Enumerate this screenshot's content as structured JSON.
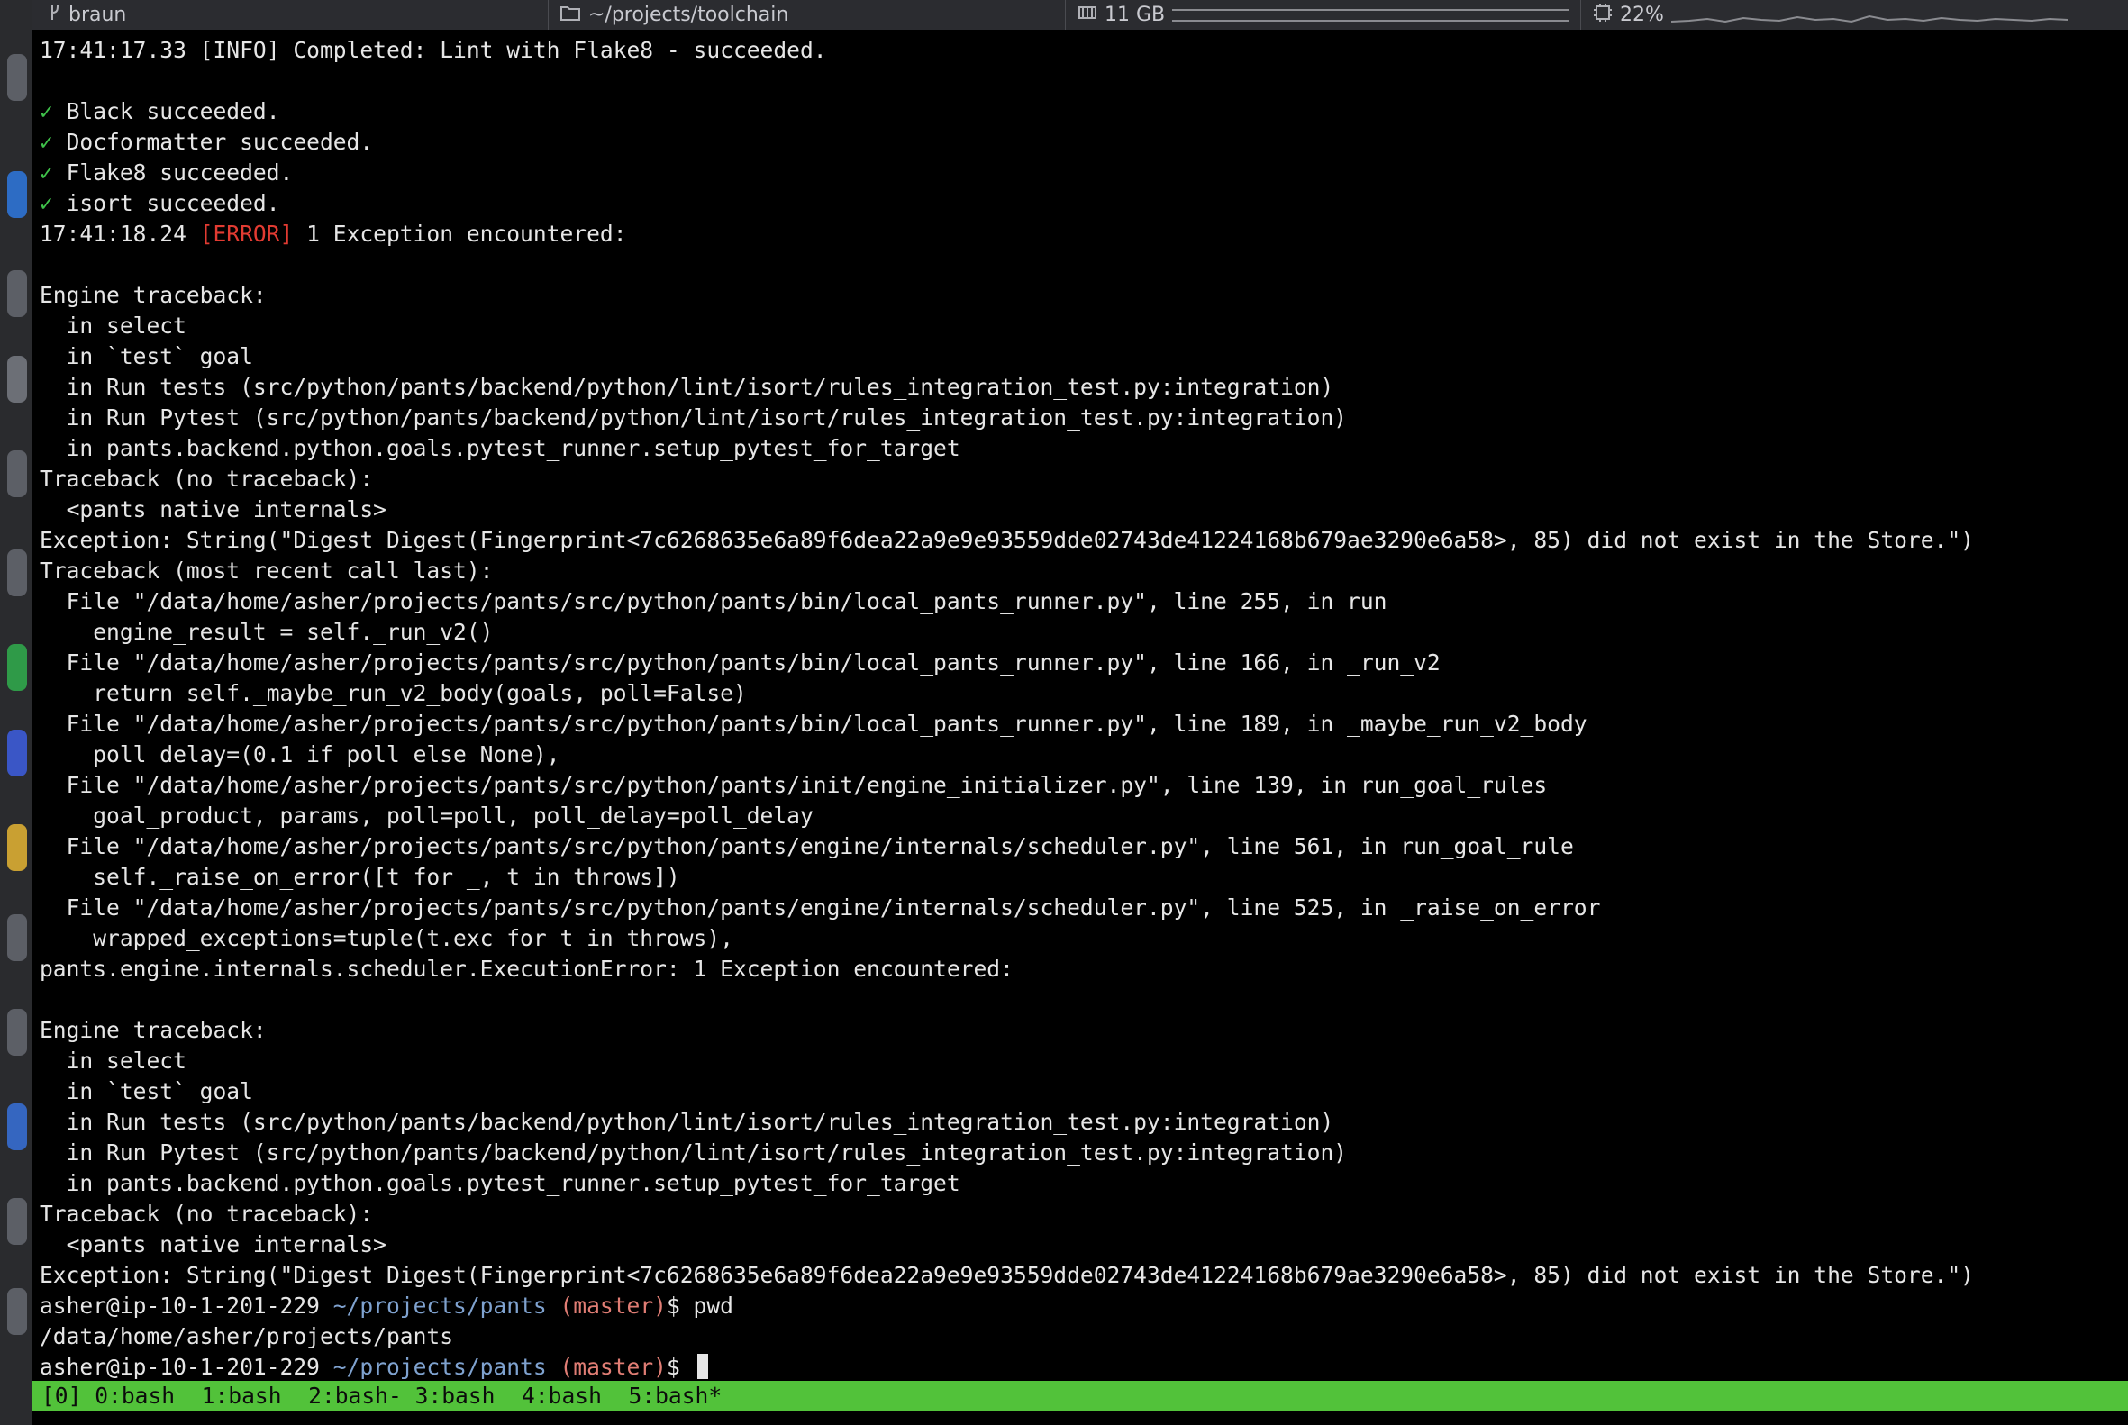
{
  "topbar": {
    "host_icon": "branch-icon",
    "host": "braun",
    "path_icon": "folder-icon",
    "path": "~/projects/toolchain",
    "mem_icon": "memory-icon",
    "mem": "11 GB",
    "cpu_icon": "cpu-icon",
    "cpu": "22%"
  },
  "terminal": {
    "lines": [
      {
        "text": "17:41:17.33 [INFO] Completed: Lint with Flake8 - succeeded."
      },
      {
        "text": ""
      },
      {
        "check": "✓",
        "text": " Black succeeded."
      },
      {
        "check": "✓",
        "text": " Docformatter succeeded."
      },
      {
        "check": "✓",
        "text": " Flake8 succeeded."
      },
      {
        "check": "✓",
        "text": " isort succeeded."
      },
      {
        "pre": "17:41:18.24 ",
        "err": "[ERROR]",
        "post": " 1 Exception encountered:"
      },
      {
        "text": ""
      },
      {
        "text": "Engine traceback:"
      },
      {
        "text": "  in select"
      },
      {
        "text": "  in `test` goal"
      },
      {
        "text": "  in Run tests (src/python/pants/backend/python/lint/isort/rules_integration_test.py:integration)"
      },
      {
        "text": "  in Run Pytest (src/python/pants/backend/python/lint/isort/rules_integration_test.py:integration)"
      },
      {
        "text": "  in pants.backend.python.goals.pytest_runner.setup_pytest_for_target"
      },
      {
        "text": "Traceback (no traceback):"
      },
      {
        "text": "  <pants native internals>"
      },
      {
        "text": "Exception: String(\"Digest Digest(Fingerprint<7c6268635e6a89f6dea22a9e9e93559dde02743de41224168b679ae3290e6a58>, 85) did not exist in the Store.\")"
      },
      {
        "text": "Traceback (most recent call last):"
      },
      {
        "text": "  File \"/data/home/asher/projects/pants/src/python/pants/bin/local_pants_runner.py\", line 255, in run"
      },
      {
        "text": "    engine_result = self._run_v2()"
      },
      {
        "text": "  File \"/data/home/asher/projects/pants/src/python/pants/bin/local_pants_runner.py\", line 166, in _run_v2"
      },
      {
        "text": "    return self._maybe_run_v2_body(goals, poll=False)"
      },
      {
        "text": "  File \"/data/home/asher/projects/pants/src/python/pants/bin/local_pants_runner.py\", line 189, in _maybe_run_v2_body"
      },
      {
        "text": "    poll_delay=(0.1 if poll else None),"
      },
      {
        "text": "  File \"/data/home/asher/projects/pants/src/python/pants/init/engine_initializer.py\", line 139, in run_goal_rules"
      },
      {
        "text": "    goal_product, params, poll=poll, poll_delay=poll_delay"
      },
      {
        "text": "  File \"/data/home/asher/projects/pants/src/python/pants/engine/internals/scheduler.py\", line 561, in run_goal_rule"
      },
      {
        "text": "    self._raise_on_error([t for _, t in throws])"
      },
      {
        "text": "  File \"/data/home/asher/projects/pants/src/python/pants/engine/internals/scheduler.py\", line 525, in _raise_on_error"
      },
      {
        "text": "    wrapped_exceptions=tuple(t.exc for t in throws),"
      },
      {
        "text": "pants.engine.internals.scheduler.ExecutionError: 1 Exception encountered:"
      },
      {
        "text": ""
      },
      {
        "text": "Engine traceback:"
      },
      {
        "text": "  in select"
      },
      {
        "text": "  in `test` goal"
      },
      {
        "text": "  in Run tests (src/python/pants/backend/python/lint/isort/rules_integration_test.py:integration)"
      },
      {
        "text": "  in Run Pytest (src/python/pants/backend/python/lint/isort/rules_integration_test.py:integration)"
      },
      {
        "text": "  in pants.backend.python.goals.pytest_runner.setup_pytest_for_target"
      },
      {
        "text": "Traceback (no traceback):"
      },
      {
        "text": "  <pants native internals>"
      },
      {
        "text": "Exception: String(\"Digest Digest(Fingerprint<7c6268635e6a89f6dea22a9e9e93559dde02743de41224168b679ae3290e6a58>, 85) did not exist in the Store.\")"
      },
      {
        "prompt": true,
        "user": "asher@ip-10-1-201-229 ",
        "path": "~/projects/pants",
        "branch": " (master)",
        "cmd": "$ pwd"
      },
      {
        "text": "/data/home/asher/projects/pants"
      },
      {
        "prompt": true,
        "user": "asher@ip-10-1-201-229 ",
        "path": "~/projects/pants",
        "branch": " (master)",
        "cmd": "$ ",
        "cursor": true
      }
    ]
  },
  "tmux": {
    "status": "[0] 0:bash  1:bash  2:bash- 3:bash  4:bash  5:bash*"
  }
}
